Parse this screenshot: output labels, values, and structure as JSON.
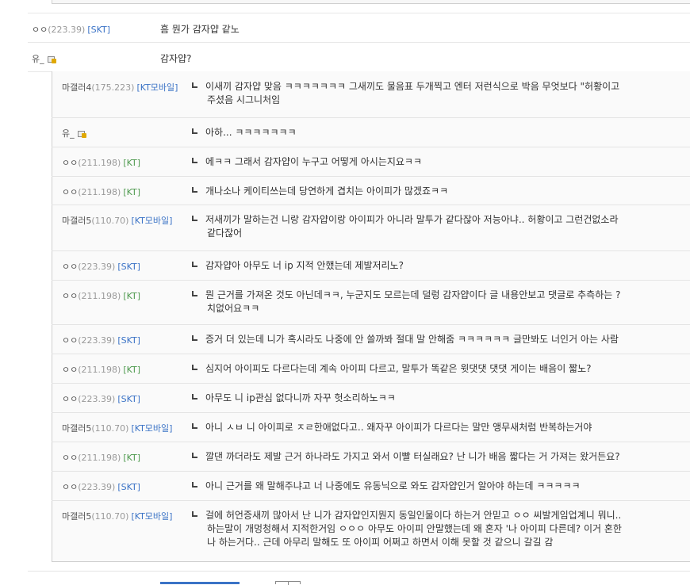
{
  "top_comments": [
    {
      "nick": "ㅇㅇ",
      "ip": "(223.39)",
      "carrier": "[SKT]",
      "carrier_type": "skt",
      "text": "흠 뭔가 감자얍 같노"
    },
    {
      "nick": "유_",
      "ip": "",
      "carrier": "",
      "carrier_type": "",
      "member_icon": true,
      "text": "감자얍?"
    }
  ],
  "replies": [
    {
      "nick": "마갤러4",
      "ip": "(175.223)",
      "carrier": "[KT모바일]",
      "carrier_type": "skt",
      "lines": [
        "이새끼 감자얍 맞음 ㅋㅋㅋㅋㅋㅋㅋ 그새끼도 물음표 두개찍고 엔터 저런식으로 박음 무엇보다 \"허황이고",
        "주셨음 시그니처임"
      ]
    },
    {
      "nick": "유_",
      "ip": "",
      "carrier": "",
      "carrier_type": "",
      "member_icon": true,
      "lines": [
        "아하... ㅋㅋㅋㅋㅋㅋㅋ"
      ]
    },
    {
      "nick": "ㅇㅇ",
      "ip": "(211.198)",
      "carrier": "[KT]",
      "carrier_type": "kt",
      "lines": [
        "에ㅋㅋ 그래서 감자얍이 누구고 어떻게 아시는지요ㅋㅋ"
      ]
    },
    {
      "nick": "ㅇㅇ",
      "ip": "(211.198)",
      "carrier": "[KT]",
      "carrier_type": "kt",
      "lines": [
        "개나소나 케이티쓰는데 당연하게 겹치는 아이피가 많겠죠ㅋㅋ"
      ]
    },
    {
      "nick": "마갤러5",
      "ip": "(110.70)",
      "carrier": "[KT모바일]",
      "carrier_type": "skt",
      "lines": [
        "저새끼가 말하는건 니랑 감자얍이랑 아이피가 아니라 말투가 같다잖아 저능아냐.. 허황이고 그런건없소라",
        "같다잖어"
      ]
    },
    {
      "nick": "ㅇㅇ",
      "ip": "(223.39)",
      "carrier": "[SKT]",
      "carrier_type": "skt",
      "lines": [
        "감자얍아 아무도 너 ip 지적 안했는데 제발저리노?"
      ]
    },
    {
      "nick": "ㅇㅇ",
      "ip": "(211.198)",
      "carrier": "[KT]",
      "carrier_type": "kt",
      "lines": [
        "뭔 근거를 가져온 것도 아닌데ㅋㅋ, 누군지도 모르는데 덜렁 감자얍이다 글 내용안보고 댓글로 추측하는 ?",
        "치없어요ㅋㅋ"
      ]
    },
    {
      "nick": "ㅇㅇ",
      "ip": "(223.39)",
      "carrier": "[SKT]",
      "carrier_type": "skt",
      "lines": [
        "증거 더 있는데 니가 혹시라도 나중에 안 쓸까봐 절대 말 안해줌 ㅋㅋㅋㅋㅋㅋ 글만봐도 너인거 아는 사람"
      ]
    },
    {
      "nick": "ㅇㅇ",
      "ip": "(211.198)",
      "carrier": "[KT]",
      "carrier_type": "kt",
      "lines": [
        "심지어 아이피도 다르다는데 계속 아이피 다르고, 말투가 똑같은 윗댓댓 댓댓 게이는 배음이 짧노?"
      ]
    },
    {
      "nick": "ㅇㅇ",
      "ip": "(223.39)",
      "carrier": "[SKT]",
      "carrier_type": "skt",
      "lines": [
        "아무도 니 ip관심 없다니까 자꾸 헛소리하노ㅋㅋ"
      ]
    },
    {
      "nick": "마갤러5",
      "ip": "(110.70)",
      "carrier": "[KT모바일]",
      "carrier_type": "skt",
      "lines": [
        "아니 ㅅㅂ 니 아이피로 ㅈㄹ한애없다고.. 왜자꾸 아이피가 다르다는 말만 앵무새처럼 반복하는거야"
      ]
    },
    {
      "nick": "ㅇㅇ",
      "ip": "(211.198)",
      "carrier": "[KT]",
      "carrier_type": "kt",
      "lines": [
        "깔댄 까더라도 제발 근거 하나라도 가지고 와서 이빨 터실래요? 난 니가 배음 짧다는 거 가져는 왔거든요?"
      ]
    },
    {
      "nick": "ㅇㅇ",
      "ip": "(223.39)",
      "carrier": "[SKT]",
      "carrier_type": "skt",
      "lines": [
        "아니 근거를 왜 말해주냐고 너 나중에도 유동닉으로 와도 감자얍인거 알아야 하는데 ㅋㅋㅋㅋㅋ"
      ]
    },
    {
      "nick": "마갤러5",
      "ip": "(110.70)",
      "carrier": "[KT모바일]",
      "carrier_type": "skt",
      "lines": [
        "걸에 허언증새끼 많아서 난 니가 감자얍인지뭔지 동일인물이다 하는거 안믿고 ㅇㅇ 씨발게임업계니 뭐니..",
        "하는말이 개멍청해서 지적한거임 ㅇㅇㅇ 아무도 아이피 안말했는데 왜 혼자 '나 아이피 다른데? 이거 혼한",
        "나 하는거다.. 근데 아무리 말해도 또 아이피 어쩌고 하면서 이해 못할 것 같으니 갈길 감"
      ]
    }
  ]
}
